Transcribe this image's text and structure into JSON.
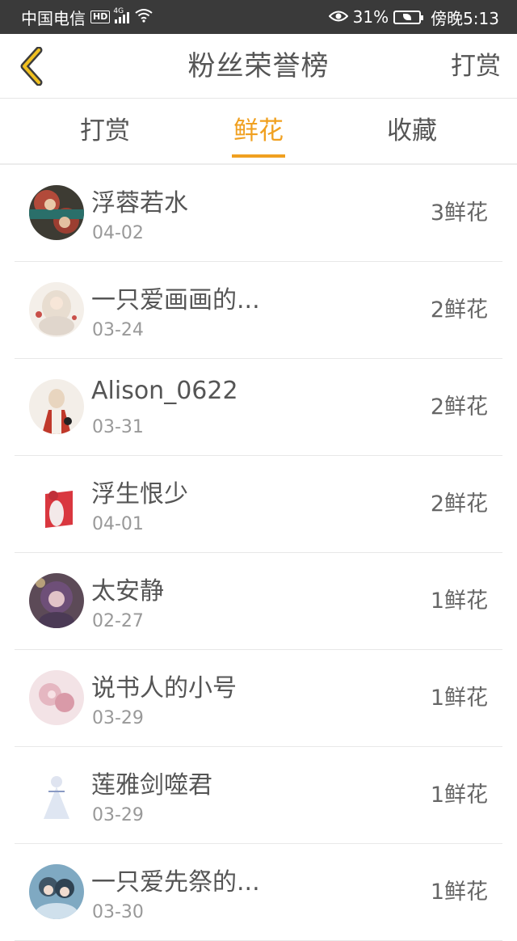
{
  "status_bar": {
    "carrier": "中国电信",
    "hd": "HD",
    "network": "4G",
    "battery_percent": "31%",
    "time": "傍晚5:13"
  },
  "navbar": {
    "back_icon": "chevron-left-icon",
    "title": "粉丝荣誉榜",
    "right_action": "打赏"
  },
  "tabs": [
    {
      "label": "打赏",
      "active": false
    },
    {
      "label": "鲜花",
      "active": true
    },
    {
      "label": "收藏",
      "active": false
    }
  ],
  "accent_color": "#f0a020",
  "fans": [
    {
      "name": "浮蓉若水",
      "date": "04-02",
      "amount": "3鲜花"
    },
    {
      "name": "一只爱画画的...",
      "date": "03-24",
      "amount": "2鲜花"
    },
    {
      "name": "Alison_0622",
      "date": "03-31",
      "amount": "2鲜花"
    },
    {
      "name": "浮生恨少",
      "date": "04-01",
      "amount": "2鲜花"
    },
    {
      "name": "太安静",
      "date": "02-27",
      "amount": "1鲜花"
    },
    {
      "name": "说书人的小号",
      "date": "03-29",
      "amount": "1鲜花"
    },
    {
      "name": "莲雅剑噬君",
      "date": "03-29",
      "amount": "1鲜花"
    },
    {
      "name": "一只爱先祭的...",
      "date": "03-30",
      "amount": "1鲜花"
    }
  ]
}
